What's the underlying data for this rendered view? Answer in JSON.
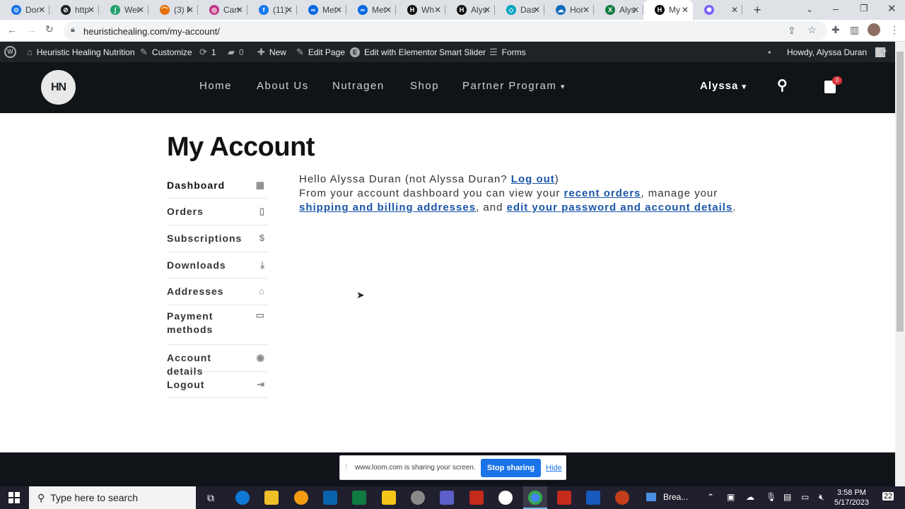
{
  "browser": {
    "tabs": [
      {
        "title": "Dor",
        "color": "#1a73e8",
        "glyph": "⊙"
      },
      {
        "title": "http",
        "color": "#202124",
        "glyph": "⊘"
      },
      {
        "title": "Wei",
        "color": "#22a06b",
        "glyph": "∫"
      },
      {
        "title": "(3) F",
        "color": "#e8710a",
        "glyph": "⌒"
      },
      {
        "title": "Can",
        "color": "#c13584",
        "glyph": "◎"
      },
      {
        "title": "(11)",
        "color": "#1877f2",
        "glyph": "f"
      },
      {
        "title": "Met",
        "color": "#0668e1",
        "glyph": "∞"
      },
      {
        "title": "Met",
        "color": "#0668e1",
        "glyph": "∞"
      },
      {
        "title": "Wh",
        "color": "#111111",
        "glyph": "H"
      },
      {
        "title": "Alys",
        "color": "#111111",
        "glyph": "H"
      },
      {
        "title": "Das",
        "color": "#00a3bf",
        "glyph": "◇"
      },
      {
        "title": "Hor",
        "color": "#0f6cbd",
        "glyph": "☁"
      },
      {
        "title": "Alys",
        "color": "#107c41",
        "glyph": "X"
      },
      {
        "title": "My",
        "color": "#111111",
        "glyph": "H"
      },
      {
        "title": "",
        "color": "#7b61ff",
        "glyph": "✺"
      }
    ],
    "active_tab_index": 13,
    "url": "heuristichealing.com/my-account/"
  },
  "wp_admin": {
    "site_name": "Heuristic Healing Nutrition",
    "customize": "Customize",
    "updates_count": "1",
    "comments_count": "0",
    "new_label": "New",
    "edit_page": "Edit Page",
    "elementor": "Edit with Elementor",
    "smart_slider": "Smart Slider",
    "forms": "Forms",
    "howdy": "Howdy, Alyssa Duran"
  },
  "site": {
    "logo_text": "HN",
    "nav": [
      "Home",
      "About Us",
      "Nutragen",
      "Shop",
      "Partner Program"
    ],
    "user": "Alyssa",
    "cart_count": "0"
  },
  "page": {
    "title": "My Account",
    "account_nav": [
      {
        "label": "Dashboard",
        "icon": "▦",
        "active": true
      },
      {
        "label": "Orders",
        "icon": "▯"
      },
      {
        "label": "Subscriptions",
        "icon": "$"
      },
      {
        "label": "Downloads",
        "icon": "⤓"
      },
      {
        "label": "Addresses",
        "icon": "⌂"
      },
      {
        "label": "Payment methods",
        "icon": "▭"
      },
      {
        "label": "Account details",
        "icon": "◉"
      },
      {
        "label": "Logout",
        "icon": "⇥"
      }
    ],
    "hello_prefix": "Hello Alyssa Duran (not Alyssa Duran? ",
    "logout_link": "Log out",
    "hello_suffix": ")",
    "dash_prefix": "From your account dashboard you can view your ",
    "recent_orders": "recent orders",
    "dash_mid": ", manage your ",
    "addresses_link": "shipping and billing addresses",
    "dash_and": ", and ",
    "account_link": "edit your password and account details",
    "dash_end": "."
  },
  "loom": {
    "text": "www.loom.com is sharing your screen.",
    "stop": "Stop sharing",
    "hide": "Hide"
  },
  "taskbar": {
    "search_placeholder": "Type here to search",
    "app_label": "Brea...",
    "time": "3:58 PM",
    "date": "5/17/2023",
    "notifications": "22"
  }
}
